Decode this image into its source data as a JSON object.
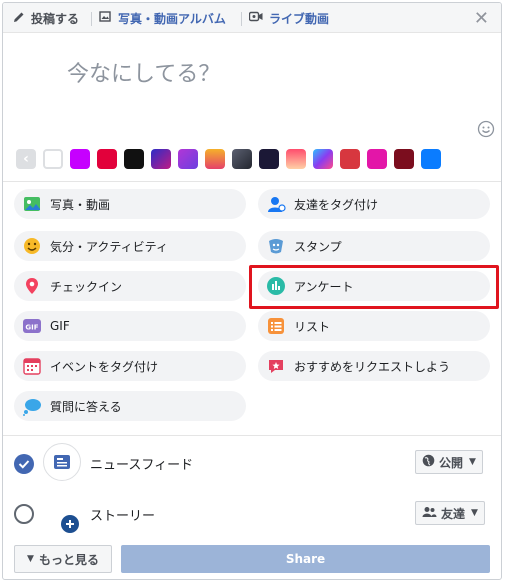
{
  "header": {
    "tabs": [
      {
        "label": "投稿する",
        "icon": "pencil-icon"
      },
      {
        "label": "写真・動画アルバム",
        "icon": "photo-album-icon"
      },
      {
        "label": "ライブ動画",
        "icon": "video-camera-icon"
      }
    ],
    "close_icon": "close-icon"
  },
  "composer": {
    "placeholder": "今なにしてる？",
    "emoji_icon": "smiley-icon"
  },
  "swatches": {
    "colors": [
      "#ffffff",
      "#c600ff",
      "#e2013b",
      "#111111",
      "#5a2bb7",
      "#8d3bd6",
      "#f08a1c",
      "#3a3f52",
      "#1b1836",
      "#f55a7a",
      "#7b5cf0",
      "#d7373f",
      "#e316a8",
      "#7b0d1e",
      "#0a7cff"
    ]
  },
  "options": [
    {
      "label": "写真・動画",
      "icon": "photo-icon"
    },
    {
      "label": "友達をタグ付け",
      "icon": "tag-friends-icon"
    },
    {
      "label": "気分・アクティビティ",
      "icon": "feeling-emoji-icon"
    },
    {
      "label": "スタンプ",
      "icon": "sticker-icon"
    },
    {
      "label": "チェックイン",
      "icon": "location-pin-icon"
    },
    {
      "label": "アンケート",
      "icon": "poll-icon"
    },
    {
      "label": "GIF",
      "icon": "gif-icon"
    },
    {
      "label": "リスト",
      "icon": "list-icon"
    },
    {
      "label": "イベントをタグ付け",
      "icon": "calendar-icon"
    },
    {
      "label": "おすすめをリクエストしよう",
      "icon": "recommendation-icon"
    },
    {
      "label": "質問に答える",
      "icon": "question-bubble-icon"
    }
  ],
  "audience": {
    "news_feed": {
      "label": "ニュースフィード",
      "privacy": "公開",
      "checked": true
    },
    "story": {
      "label": "ストーリー",
      "privacy": "友達",
      "checked": false
    }
  },
  "footer": {
    "more_label": "もっと見る",
    "share_label": "Share"
  }
}
